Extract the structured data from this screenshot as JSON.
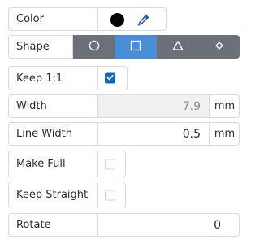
{
  "colors": {
    "accent": "#1565c0",
    "toggle_bg": "#6b7079",
    "toggle_active": "#4a8ed8",
    "disabled_bg": "#f0f0f0"
  },
  "color_row": {
    "label": "Color",
    "swatch_color": "#000000",
    "picker_icon": "eyedropper-icon"
  },
  "shape_row": {
    "label": "Shape",
    "options": [
      {
        "name": "circle",
        "icon": "circle-icon",
        "selected": false
      },
      {
        "name": "square",
        "icon": "square-icon",
        "selected": true
      },
      {
        "name": "triangle",
        "icon": "triangle-icon",
        "selected": false
      },
      {
        "name": "diamond",
        "icon": "diamond-icon",
        "selected": false
      }
    ]
  },
  "keep_ratio": {
    "label": "Keep 1:1",
    "checked": true
  },
  "width": {
    "label": "Width",
    "value": "7.9",
    "unit": "mm",
    "disabled": true
  },
  "line_width": {
    "label": "Line Width",
    "value": "0.5",
    "unit": "mm"
  },
  "make_full": {
    "label": "Make Full",
    "checked": false
  },
  "keep_straight": {
    "label": "Keep Straight",
    "checked": false
  },
  "rotate": {
    "label": "Rotate",
    "value": "0"
  }
}
